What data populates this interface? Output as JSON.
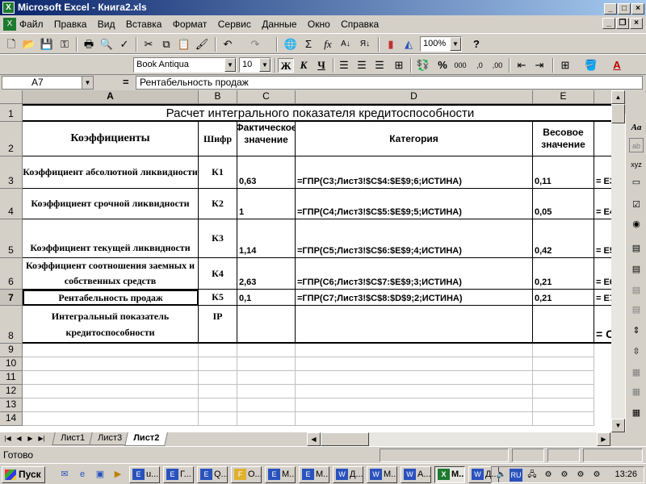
{
  "window": {
    "title": "Microsoft Excel - Книга2.xls",
    "app_icon": "X"
  },
  "menu": [
    "Файл",
    "Правка",
    "Вид",
    "Вставка",
    "Формат",
    "Сервис",
    "Данные",
    "Окно",
    "Справка"
  ],
  "toolbar": {
    "zoom": "100%",
    "font_name": "Book Antiqua",
    "font_size": "10",
    "bold_label": "Ж",
    "italic_label": "К",
    "underline_label": "Ч",
    "percent_label": "%",
    "thousands_label": "000"
  },
  "formula_bar": {
    "name_box": "A7",
    "eq": "=",
    "fx": "fx",
    "content": "Рентабельность продаж"
  },
  "columns": [
    "A",
    "B",
    "C",
    "D",
    "E"
  ],
  "rows": [
    "1",
    "2",
    "3",
    "4",
    "5",
    "6",
    "7",
    "8",
    "9",
    "10",
    "11",
    "12",
    "13",
    "14"
  ],
  "sheet": {
    "title": "Расчет интегрального показателя кредитоспособности",
    "headers": {
      "a": "Коэффициенты",
      "b": "Шифр",
      "c": "Фактическое значение",
      "d": "Категория",
      "e": "Весовое значение"
    },
    "data_rows": [
      {
        "name": "Коэффициент абсолютной ликвидности",
        "code": "К1",
        "actual": "0,63",
        "category": "=ГПР(C3;Лист3!$C$4:$E$9;6;ИСТИНА)",
        "weight": "0,11",
        "f": "= E3"
      },
      {
        "name": "Коэффициент срочной ликвидности",
        "code": "К2",
        "actual": "1",
        "category": "=ГПР(C4;Лист3!$C$5:$E$9;5;ИСТИНА)",
        "weight": "0,05",
        "f": "= E4"
      },
      {
        "name": "Коэффициент текущей ликвидности",
        "code": "К3",
        "actual": "1,14",
        "category": "=ГПР(C5;Лист3!$C$6:$E$9;4;ИСТИНА)",
        "weight": "0,42",
        "f": "= E5"
      },
      {
        "name": "Коэффициент соотношения заемных и собственных средств",
        "code": "К4",
        "actual": "2,63",
        "category": "=ГПР(C6;Лист3!$C$7:$E$9;3;ИСТИНА)",
        "weight": "0,21",
        "f": "= E6"
      },
      {
        "name": "Рентабельность продаж",
        "code": "К5",
        "actual": "0,1",
        "category": "=ГПР(C7;Лист3!$C$8:$D$9;2;ИСТИНА)",
        "weight": "0,21",
        "f": "= E7"
      }
    ],
    "integral": {
      "name": "Интегральный показатель кредитоспособности",
      "code": "IP",
      "f": "= C"
    }
  },
  "tabs": [
    "Лист1",
    "Лист3",
    "Лист2"
  ],
  "status": "Готово",
  "taskbar": {
    "start": "Пуск",
    "tasks": [
      {
        "icon": "E",
        "label": "u..."
      },
      {
        "icon": "E",
        "label": "Г..."
      },
      {
        "icon": "E",
        "label": "Q..."
      },
      {
        "icon": "F",
        "label": "О..."
      },
      {
        "icon": "E",
        "label": "М..."
      },
      {
        "icon": "E",
        "label": "М..."
      },
      {
        "icon": "W",
        "label": "Д..."
      },
      {
        "icon": "W",
        "label": "М..."
      },
      {
        "icon": "W",
        "label": "А..."
      },
      {
        "icon": "X",
        "label": "М..."
      },
      {
        "icon": "W",
        "label": "Д..."
      }
    ],
    "lang": "RU",
    "clock": "13:26"
  },
  "colors": {
    "title_start": "#0a246a",
    "title_end": "#a6caf0",
    "excel_green": "#1e7a2e",
    "word_blue": "#2a52be"
  }
}
